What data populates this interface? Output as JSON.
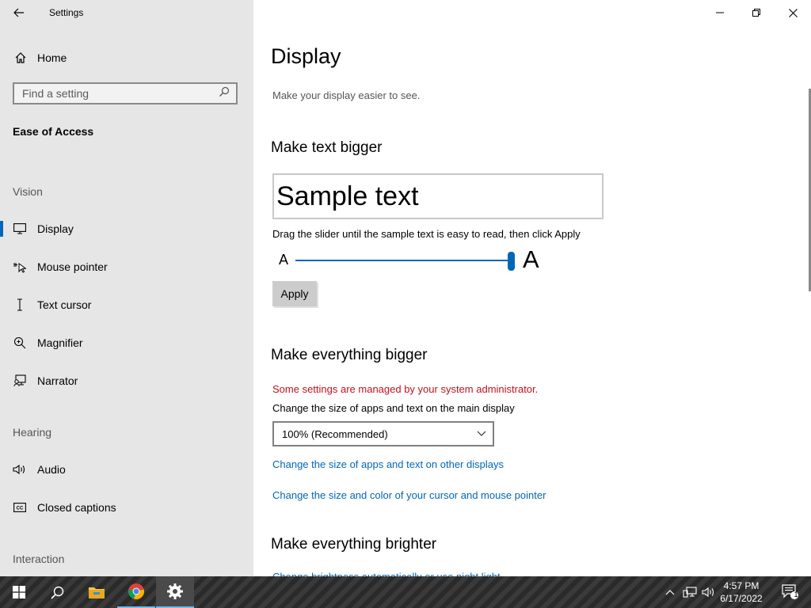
{
  "window": {
    "title": "Settings"
  },
  "sidebar": {
    "home_label": "Home",
    "search_placeholder": "Find a setting",
    "section_title": "Ease of Access",
    "groups": {
      "vision": "Vision",
      "hearing": "Hearing",
      "interaction": "Interaction"
    },
    "items": [
      {
        "label": "Display",
        "icon": "monitor-icon",
        "active": true
      },
      {
        "label": "Mouse pointer",
        "icon": "mouse-pointer-icon"
      },
      {
        "label": "Text cursor",
        "icon": "text-cursor-icon"
      },
      {
        "label": "Magnifier",
        "icon": "magnifier-icon"
      },
      {
        "label": "Narrator",
        "icon": "narrator-icon"
      },
      {
        "label": "Audio",
        "icon": "speaker-icon"
      },
      {
        "label": "Closed captions",
        "icon": "closed-captions-icon"
      }
    ]
  },
  "main": {
    "title": "Display",
    "description": "Make your display easier to see.",
    "text_bigger": {
      "heading": "Make text bigger",
      "sample": "Sample text",
      "instruction": "Drag the slider until the sample text is easy to read, then click Apply",
      "small_letter": "A",
      "big_letter": "A",
      "slider_value": 1.0,
      "apply_label": "Apply"
    },
    "everything_bigger": {
      "heading": "Make everything bigger",
      "warning": "Some settings are managed by your system administrator.",
      "label": "Change the size of apps and text on the main display",
      "dropdown_value": "100% (Recommended)",
      "link_other_displays": "Change the size of apps and text on other displays",
      "link_cursor": "Change the size and color of your cursor and mouse pointer"
    },
    "brighter": {
      "heading": "Make everything brighter",
      "cut_link": "Change brightness automatically or use night light"
    }
  },
  "taskbar": {
    "time": "4:57 PM",
    "date": "6/17/2022",
    "notification_count": "1"
  },
  "colors": {
    "accent": "#0067b8",
    "warning": "#c50f1f",
    "sidebar_bg": "#e6e6e6"
  }
}
